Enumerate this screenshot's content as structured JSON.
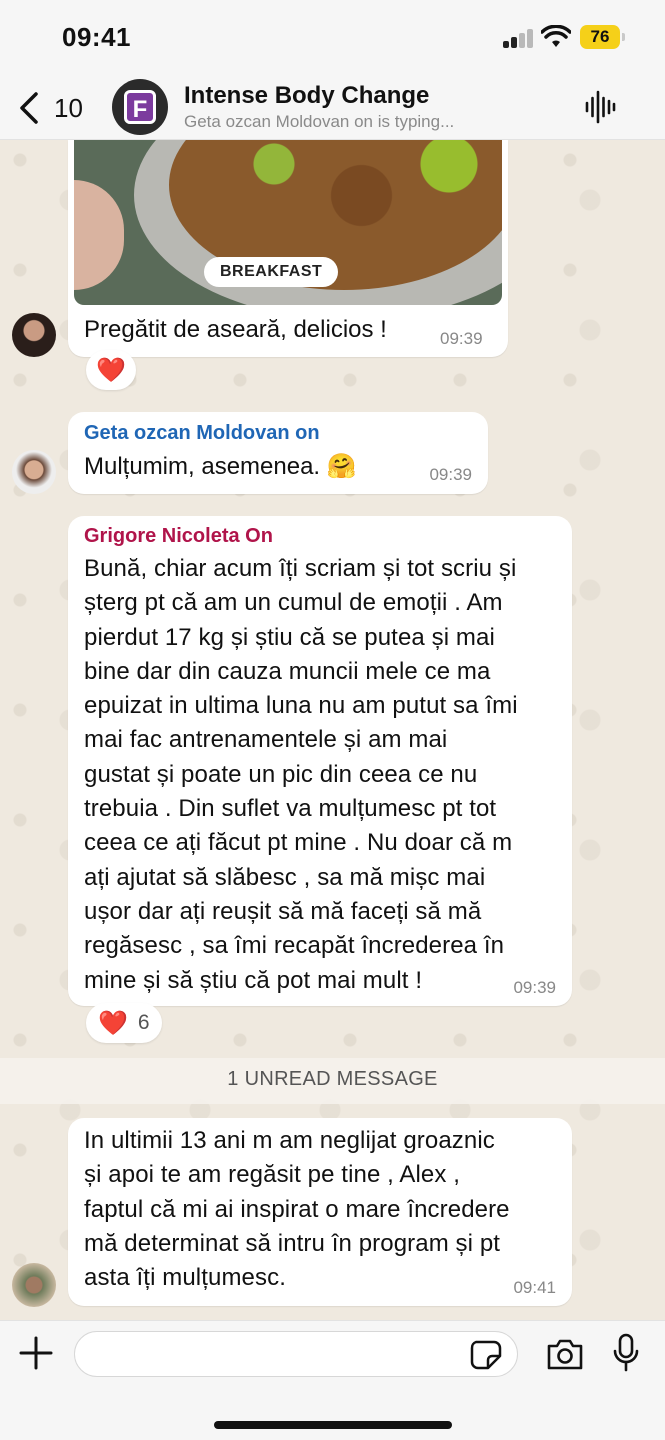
{
  "status_bar": {
    "time": "09:41",
    "battery": "76"
  },
  "header": {
    "back_count": "10",
    "title": "Intense Body Change",
    "subtitle": "Geta ozcan Moldovan on is typing...",
    "logo_letter": "F"
  },
  "messages": [
    {
      "photo_tag": "BREAKFAST",
      "text": "Pregătit de aseară, delicios !",
      "time": "09:39",
      "reaction": "❤️"
    },
    {
      "sender": "Geta ozcan Moldovan on",
      "sender_color": "#1f66b5",
      "text": "Mulțumim, asemenea.",
      "emoji": "🤗",
      "time": "09:39"
    },
    {
      "sender": "Grigore Nicoleta On",
      "sender_color": "#b0144a",
      "lines": [
        "Bună, chiar acum îți scriam și tot scriu și",
        "șterg pt că am un cumul de emoții . Am",
        "pierdut 17 kg și știu că se putea și mai",
        "bine dar din cauza muncii mele ce ma",
        "epuizat in ultima luna nu am putut sa îmi",
        "mai fac antrenamentele și am mai",
        "gustat și poate un pic din ceea ce nu",
        "trebuia . Din suflet va mulțumesc pt tot",
        "ceea ce ați făcut pt mine . Nu doar că m",
        "ați ajutat să slăbesc , sa mă mișc mai",
        "ușor dar ați reușit să mă faceți să mă",
        "regăsesc , sa îmi recapăt încrederea în",
        "mine și să știu că pot mai mult !"
      ],
      "time": "09:39",
      "reaction": "❤️",
      "reaction_count": "6"
    },
    {
      "lines": [
        "In ultimii 13 ani m am neglijat  groaznic",
        "și apoi te am regăsit pe tine , Alex ,",
        "faptul că mi ai inspirat o mare încredere",
        "mă determinat să intru în program și pt",
        "asta îți mulțumesc."
      ],
      "time": "09:41"
    }
  ],
  "unread_label": "1 UNREAD MESSAGE",
  "input": {
    "placeholder": ""
  }
}
